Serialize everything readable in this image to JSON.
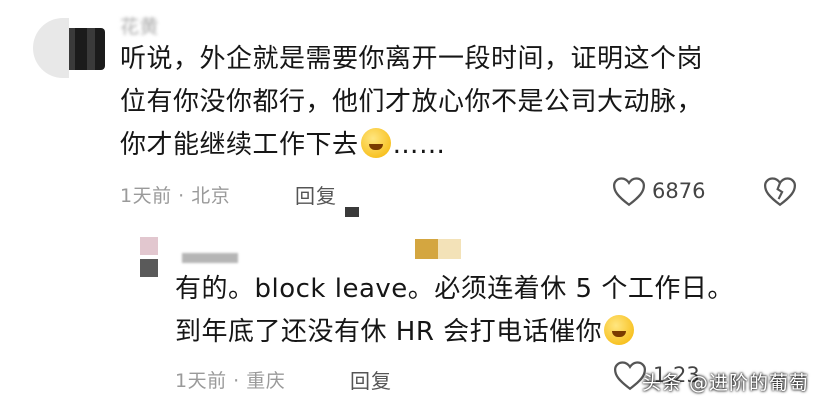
{
  "comment": {
    "username": "花黄",
    "line1": "听说，外企就是需要你离开一段时间，证明这个岗",
    "line2": "位有你没你都行，他们才放心你不是公司大动脉，",
    "line3_text": "你才能继续工作下去",
    "line3_suffix": "……",
    "emoji": "laughing-with-tears",
    "meta": "1天前 · 北京",
    "reply_label": "回复",
    "like_count": "6876"
  },
  "reply": {
    "line1": "有的。block leave。必须连着休 5 个工作日。",
    "line2": "到年底了还没有休 HR 会打电话催你",
    "emoji": "grinning",
    "meta": "1天前 · 重庆",
    "reply_label": "回复",
    "like_count": "1,23"
  },
  "watermark": "头条 @进阶的葡萄"
}
